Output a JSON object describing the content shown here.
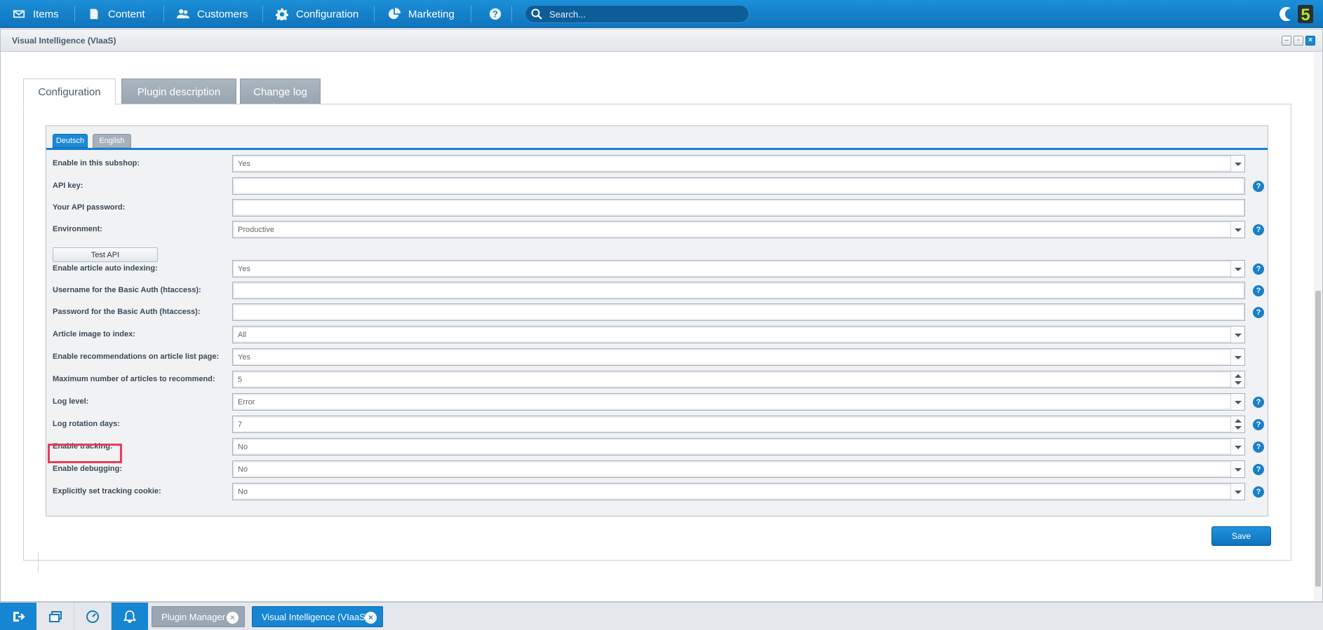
{
  "topnav": {
    "items": [
      {
        "label": "Items",
        "icon": "inbox-icon"
      },
      {
        "label": "Content",
        "icon": "document-icon"
      },
      {
        "label": "Customers",
        "icon": "users-icon"
      },
      {
        "label": "Configuration",
        "icon": "gear-icon"
      },
      {
        "label": "Marketing",
        "icon": "pie-chart-icon"
      }
    ],
    "help_icon": "help-icon",
    "search_placeholder": "Search...",
    "logo": "shopware-logo",
    "logo_text": "5"
  },
  "window": {
    "title": "Visual Intelligence (VIaaS)"
  },
  "tabs": [
    {
      "label": "Configuration",
      "active": true
    },
    {
      "label": "Plugin description",
      "active": false
    },
    {
      "label": "Change log",
      "active": false
    }
  ],
  "language_tabs": [
    {
      "label": "Deutsch",
      "active": true
    },
    {
      "label": "English",
      "active": false
    }
  ],
  "form": {
    "rows": [
      {
        "label": "Enable in this subshop:",
        "value": "Yes",
        "type": "select",
        "help": false
      },
      {
        "label": "API key:",
        "value": "",
        "type": "text",
        "help": true
      },
      {
        "label": "Your API password:",
        "value": "",
        "type": "text",
        "help": false
      },
      {
        "label": "Environment:",
        "value": "Productive",
        "type": "select",
        "help": true
      },
      {
        "label": "Enable article auto indexing:",
        "value": "Yes",
        "type": "select",
        "help": true
      },
      {
        "label": "Username for the Basic Auth (htaccess):",
        "value": "",
        "type": "text",
        "help": true
      },
      {
        "label": "Password for the Basic Auth (htaccess):",
        "value": "",
        "type": "text",
        "help": true
      },
      {
        "label": "Article image to index:",
        "value": "All",
        "type": "select",
        "help": false
      },
      {
        "label": "Enable recommendations on article list page:",
        "value": "Yes",
        "type": "select",
        "help": false
      },
      {
        "label": "Maximum number of articles to recommend:",
        "value": "5",
        "type": "number",
        "help": false
      },
      {
        "label": "Log level:",
        "value": "Error",
        "type": "select",
        "help": true
      },
      {
        "label": "Log rotation days:",
        "value": "7",
        "type": "number",
        "help": true
      },
      {
        "label": "Enable tracking:",
        "value": "No",
        "type": "select",
        "help": true,
        "highlighted": true
      },
      {
        "label": "Enable debugging:",
        "value": "No",
        "type": "select",
        "help": true
      },
      {
        "label": "Explicitly set tracking cookie:",
        "value": "No",
        "type": "select",
        "help": true
      }
    ],
    "test_api_label": "Test API",
    "help_glyph": "?"
  },
  "save_label": "Save",
  "taskbar": {
    "icons": [
      "logout-icon",
      "windows-icon",
      "dashboard-icon",
      "notification-bell-icon"
    ],
    "tabs": [
      {
        "label": "Plugin Manager",
        "active": false
      },
      {
        "label": "Visual Intelligence (VIaaS)",
        "active": true
      }
    ],
    "close_glyph": "×"
  },
  "colors": {
    "accent": "#1a8ad6",
    "highlight_border": "#e83e5a"
  }
}
